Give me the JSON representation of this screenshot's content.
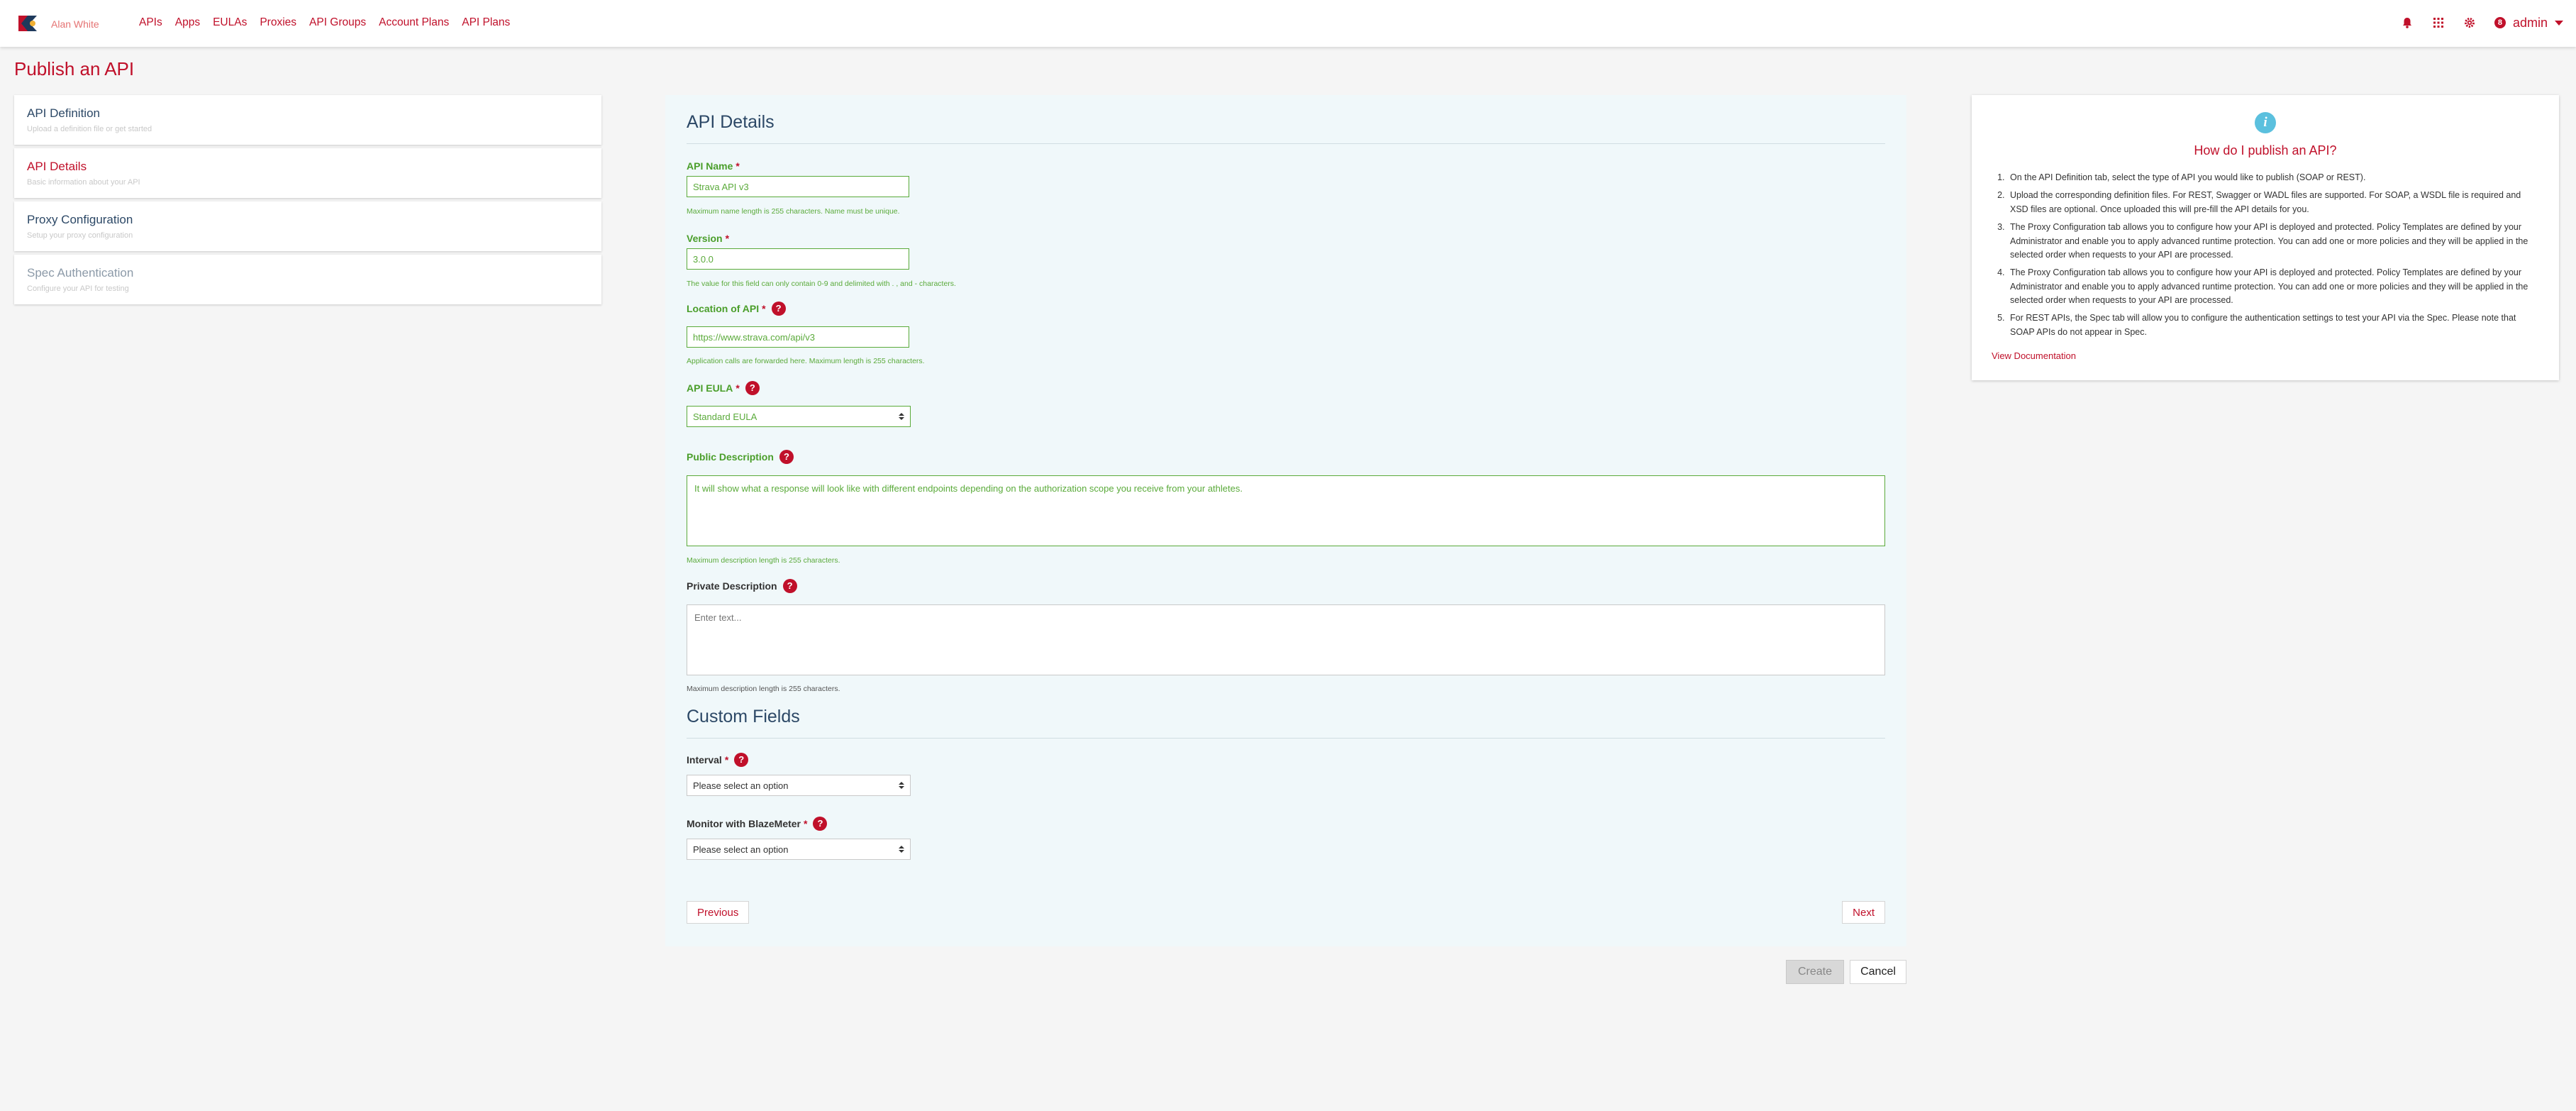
{
  "header": {
    "user_name": "Alan White",
    "nav": [
      "APIs",
      "Apps",
      "EULAs",
      "Proxies",
      "API Groups",
      "Account Plans",
      "API Plans"
    ],
    "admin_badge": "8",
    "admin_label": "admin"
  },
  "page": {
    "title": "Publish an API"
  },
  "steps": [
    {
      "title": "API Definition",
      "subtitle": "Upload a definition file or get started"
    },
    {
      "title": "API Details",
      "subtitle": "Basic information about your API"
    },
    {
      "title": "Proxy Configuration",
      "subtitle": "Setup your proxy configuration"
    },
    {
      "title": "Spec Authentication",
      "subtitle": "Configure your API for testing"
    }
  ],
  "form": {
    "section_title": "API Details",
    "api_name": {
      "label": "API Name",
      "value": "Strava API v3",
      "hint": "Maximum name length is 255 characters. Name must be unique."
    },
    "version": {
      "label": "Version",
      "value": "3.0.0",
      "hint": "The value for this field can only contain 0-9 and delimited with . , and - characters."
    },
    "location": {
      "label": "Location of API",
      "value": "https://www.strava.com/api/v3",
      "hint": "Application calls are forwarded here. Maximum length is 255 characters."
    },
    "eula": {
      "label": "API EULA",
      "value": "Standard EULA"
    },
    "public_description": {
      "label": "Public Description",
      "value": "It will show what a response will look like with different endpoints depending on the authorization scope you receive from your athletes.",
      "hint": "Maximum description length is 255 characters."
    },
    "private_description": {
      "label": "Private Description",
      "placeholder": "Enter text...",
      "hint": "Maximum description length is 255 characters."
    },
    "custom_title": "Custom Fields",
    "interval": {
      "label": "Interval",
      "value": "Please select an option"
    },
    "blazemeter": {
      "label": "Monitor with BlazeMeter",
      "value": "Please select an option"
    },
    "required_mark": "*",
    "help_mark": "?",
    "previous_label": "Previous",
    "next_label": "Next"
  },
  "actions": {
    "create_label": "Create",
    "cancel_label": "Cancel"
  },
  "help_panel": {
    "info_glyph": "i",
    "title": "How do I publish an API?",
    "items": [
      "On the API Definition tab, select the type of API you would like to publish (SOAP or REST).",
      "Upload the corresponding definition files. For REST, Swagger or WADL files are supported. For SOAP, a WSDL file is required and XSD files are optional. Once uploaded this will pre-fill the API details for you.",
      "The Proxy Configuration tab allows you to configure how your API is deployed and protected. Policy Templates are defined by your Administrator and enable you to apply advanced runtime protection. You can add one or more policies and they will be applied in the selected order when requests to your API are processed.",
      "The Proxy Configuration tab allows you to configure how your API is deployed and protected. Policy Templates are defined by your Administrator and enable you to apply advanced runtime protection. You can add one or more policies and they will be applied in the selected order when requests to your API are processed.",
      "For REST APIs, the Spec tab will allow you to configure the authentication settings to test your API via the Spec. Please note that SOAP APIs do not appear in Spec."
    ],
    "doc_link": "View Documentation"
  },
  "colors": {
    "brand": "#c0102a",
    "valid": "#5aaa3a",
    "heading": "#2c4866",
    "panel_bg": "#f0f8fa",
    "info": "#5bc0de"
  }
}
